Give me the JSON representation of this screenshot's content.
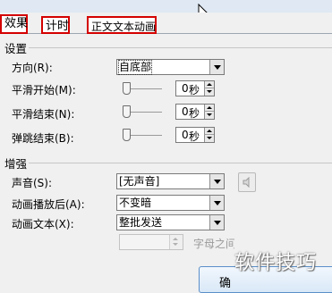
{
  "tabs": [
    {
      "label": "效果"
    },
    {
      "label": "计时"
    },
    {
      "label": "正文文本动画"
    }
  ],
  "settings": {
    "heading": "设置",
    "direction": {
      "label": "方向(R):",
      "value": "自底部"
    },
    "smooth_start": {
      "label": "平滑开始(M):",
      "value": "0",
      "unit": "秒"
    },
    "smooth_end": {
      "label": "平滑结束(N):",
      "value": "0",
      "unit": "秒"
    },
    "bounce_end": {
      "label": "弹跳结束(B):",
      "value": "0",
      "unit": "秒"
    }
  },
  "enhancements": {
    "heading": "增强",
    "sound": {
      "label": "声音(S):",
      "value": "[无声音]"
    },
    "after_animation": {
      "label": "动画播放后(A):",
      "value": "不变暗"
    },
    "animate_text": {
      "label": "动画文本(X):",
      "value": "整批发送"
    },
    "letter_delay_label": "字母之间"
  },
  "ok_button": {
    "label": "确"
  },
  "watermark": "软件技巧",
  "icons": {
    "cursor": "mouse-cursor-icon",
    "speaker": "speaker-icon"
  }
}
